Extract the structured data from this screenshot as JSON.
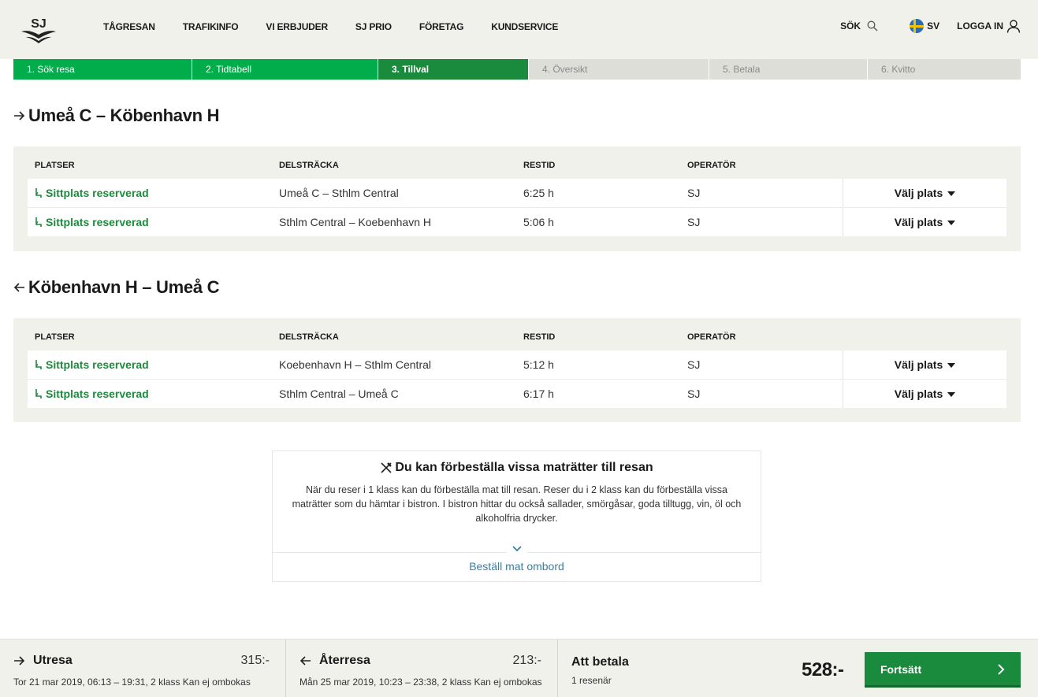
{
  "header": {
    "logo_text": "SJ",
    "nav": [
      "TÅGRESAN",
      "TRAFIKINFO",
      "VI ERBJUDER",
      "SJ PRIO",
      "FÖRETAG",
      "KUNDSERVICE"
    ],
    "search_label": "SÖK",
    "language_label": "SV",
    "login_label": "LOGGA IN"
  },
  "steps": [
    {
      "label": "1. Sök resa",
      "state": "done"
    },
    {
      "label": "2. Tidtabell",
      "state": "done"
    },
    {
      "label": "3. Tillval",
      "state": "active"
    },
    {
      "label": "4. Översikt",
      "state": "todo"
    },
    {
      "label": "5. Betala",
      "state": "todo"
    },
    {
      "label": "6. Kvitto",
      "state": "todo"
    }
  ],
  "outbound": {
    "title": "Umeå C – Köbenhavn H",
    "headers": {
      "platser": "PLATSER",
      "delstracka": "DELSTRÄCKA",
      "restid": "RESTID",
      "operator": "OPERATÖR"
    },
    "rows": [
      {
        "seat": "Sittplats reserverad",
        "segment": "Umeå C – Sthlm Central",
        "time": "6:25 h",
        "operator": "SJ",
        "action": "Välj plats"
      },
      {
        "seat": "Sittplats reserverad",
        "segment": "Sthlm Central – Koebenhavn H",
        "time": "5:06 h",
        "operator": "SJ",
        "action": "Välj plats"
      }
    ]
  },
  "return": {
    "title": "Köbenhavn H – Umeå C",
    "headers": {
      "platser": "PLATSER",
      "delstracka": "DELSTRÄCKA",
      "restid": "RESTID",
      "operator": "OPERATÖR"
    },
    "rows": [
      {
        "seat": "Sittplats reserverad",
        "segment": "Koebenhavn H – Sthlm Central",
        "time": "5:12 h",
        "operator": "SJ",
        "action": "Välj plats"
      },
      {
        "seat": "Sittplats reserverad",
        "segment": "Sthlm Central – Umeå C",
        "time": "6:17 h",
        "operator": "SJ",
        "action": "Välj plats"
      }
    ]
  },
  "food": {
    "title": "Du kan förbeställa vissa maträtter till resan",
    "text": "När du reser i 1 klass kan du förbeställa mat till resan. Reser du i 2 klass kan du förbeställa vissa maträtter som du hämtar i bistron. I bistron hittar du också sallader, smörgåsar, goda tilltugg, vin, öl och alkoholfria drycker.",
    "link": "Beställ mat ombord"
  },
  "footer": {
    "out_label": "Utresa",
    "out_price": "315:-",
    "out_details": "Tor 21 mar 2019, 06:13 – 19:31, 2 klass Kan ej ombokas",
    "ret_label": "Återresa",
    "ret_price": "213:-",
    "ret_details": "Mån 25 mar 2019, 10:23 – 23:38, 2 klass Kan ej ombokas",
    "pay_label": "Att betala",
    "travelers": "1 resenär",
    "total": "528:-",
    "continue_label": "Fortsätt"
  },
  "colors": {
    "primary_green": "#1a8a3d",
    "step_done": "#00ad4a",
    "seat_green": "#1e8a3e",
    "link_blue": "#3a7ea3",
    "panel_bg": "#f1f1ec"
  }
}
